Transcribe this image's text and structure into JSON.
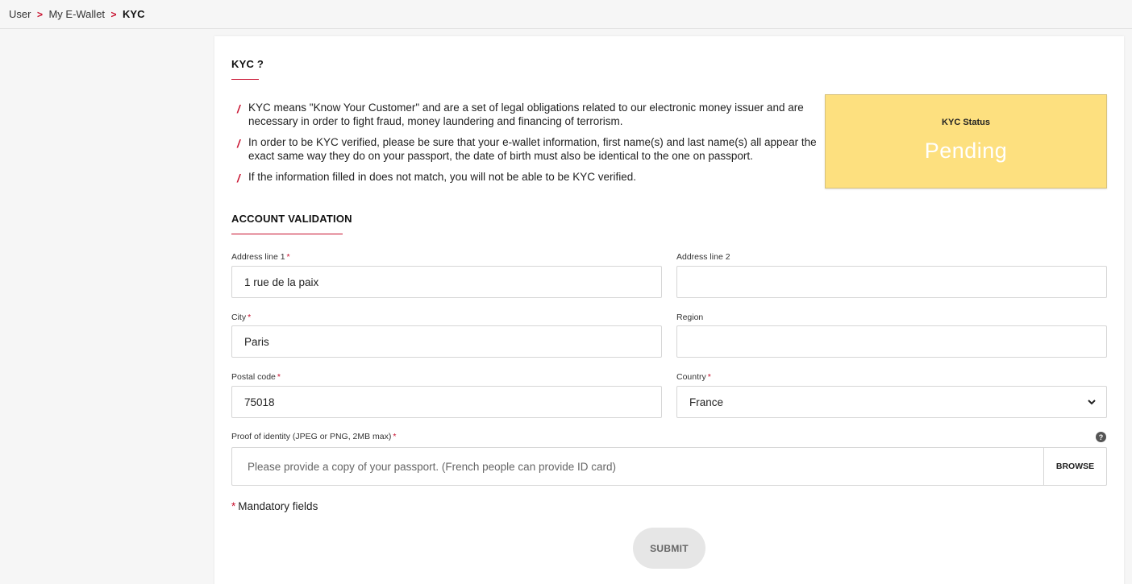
{
  "breadcrumb": {
    "items": [
      "User",
      "My E-Wallet",
      "KYC"
    ],
    "separator": ">"
  },
  "kyc_section": {
    "title": "KYC ?",
    "bullets": [
      "KYC means \"Know Your Customer\" and are a set of legal obligations related to our electronic money issuer and are necessary in order to fight fraud, money laundering and financing of terrorism.",
      "In order to be KYC verified, please be sure that your e-wallet information, first name(s) and last name(s) all appear the exact same way they do on your passport, the date of birth must also be identical to the one on passport.",
      "If the information filled in does not match, you will not be able to be KYC verified."
    ],
    "bullet_marker": "/"
  },
  "status": {
    "label": "KYC Status",
    "value": "Pending",
    "color": "#fde07f"
  },
  "account_validation": {
    "title": "ACCOUNT VALIDATION",
    "required_marker": "*",
    "fields": {
      "address1": {
        "label": "Address line 1",
        "value": "1 rue de la paix"
      },
      "address2": {
        "label": "Address line 2",
        "value": ""
      },
      "city": {
        "label": "City",
        "value": "Paris"
      },
      "region": {
        "label": "Region",
        "value": ""
      },
      "postal": {
        "label": "Postal code",
        "value": "75018"
      },
      "country": {
        "label": "Country",
        "value": "France"
      },
      "proof": {
        "label": "Proof of identity (JPEG or PNG, 2MB max)",
        "placeholder": "Please provide a copy of your passport. (French people can provide ID card)",
        "browse_label": "BROWSE",
        "help_icon": "?"
      }
    },
    "mandatory_note": "Mandatory fields",
    "submit_label": "SUBMIT"
  },
  "colors": {
    "accent": "#c8102e",
    "status_bg": "#fde07f",
    "button_bg": "#e6e6e6"
  }
}
